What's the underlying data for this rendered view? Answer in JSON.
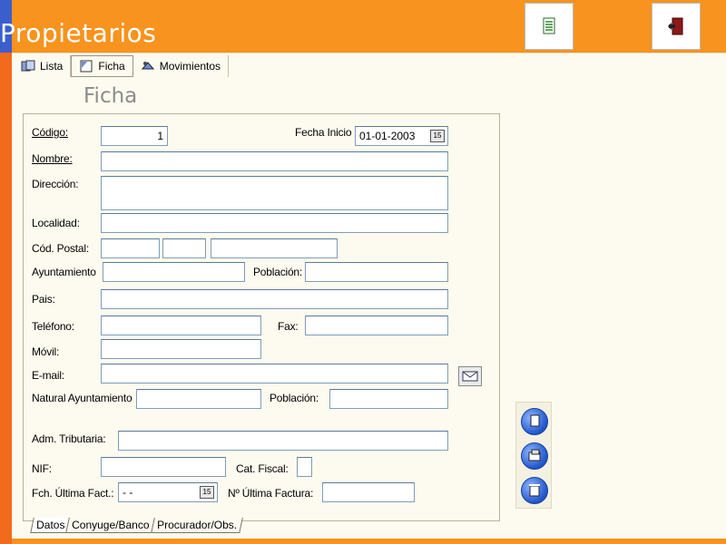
{
  "app": {
    "title": "Propietarios"
  },
  "toolbar": {
    "report_icon": "document-icon",
    "exit_icon": "exit-door-icon"
  },
  "tabs": [
    {
      "label": "Lista",
      "icon": "list-icon"
    },
    {
      "label": "Ficha",
      "icon": "card-icon"
    },
    {
      "label": "Movimientos",
      "icon": "movements-icon"
    }
  ],
  "section_title": "Ficha",
  "form": {
    "codigo_label": "Código:",
    "codigo_value": "1",
    "fecha_inicio_label": "Fecha Inicio",
    "fecha_inicio_value": "01-01-2003",
    "nombre_label": "Nombre:",
    "direccion_label": "Dirección:",
    "localidad_label": "Localidad:",
    "cod_postal_label": "Cód. Postal:",
    "ayuntamiento_label": "Ayuntamiento",
    "poblacion_label": "Población:",
    "pais_label": "Pais:",
    "telefono_label": "Teléfono:",
    "fax_label": "Fax:",
    "movil_label": "Móvil:",
    "email_label": "E-mail:",
    "natural_ayuntamiento_label": "Natural Ayuntamiento",
    "natural_poblacion_label": "Población:",
    "adm_tributaria_label": "Adm. Tributaria:",
    "nif_label": "NIF:",
    "cat_fiscal_label": "Cat. Fiscal:",
    "fch_ultima_fact_label": "Fch. Última Fact.:",
    "fch_ultima_fact_value": " -  -",
    "num_ultima_factura_label": "Nº Última Factura:"
  },
  "side_buttons": [
    "new-record-icon",
    "save-record-icon",
    "delete-record-icon"
  ],
  "bottom_tabs": [
    {
      "label": "Datos"
    },
    {
      "label": "Conyuge/Banco"
    },
    {
      "label": "Procurador/Obs."
    }
  ],
  "colors": {
    "header_orange": "#f7931e",
    "accent_blue": "#3a5fcd",
    "panel_bg": "#fdfbef"
  }
}
